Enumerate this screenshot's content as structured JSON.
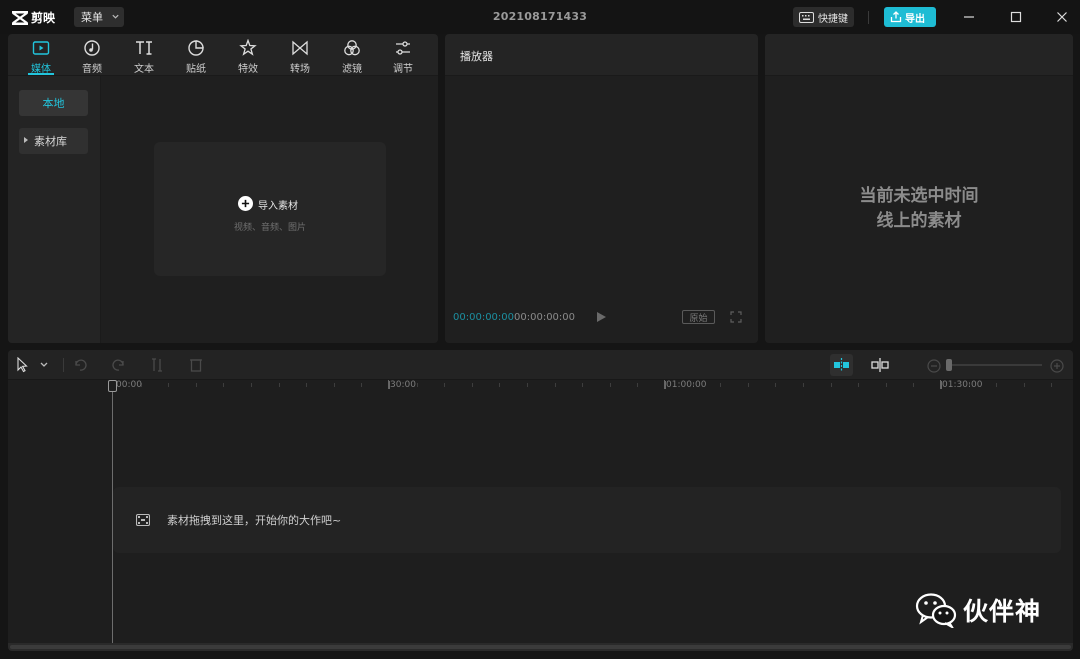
{
  "app": {
    "name": "剪映",
    "menu_label": "菜单",
    "document_title": "202108171433",
    "shortcut_label": "快捷键",
    "export_label": "导出",
    "accent_color": "#22c5dd"
  },
  "media_tabs": [
    {
      "label": "媒体",
      "icon": "media-icon",
      "active": true
    },
    {
      "label": "音频",
      "icon": "audio-icon",
      "active": false
    },
    {
      "label": "文本",
      "icon": "text-icon",
      "active": false
    },
    {
      "label": "贴纸",
      "icon": "sticker-icon",
      "active": false
    },
    {
      "label": "特效",
      "icon": "effects-icon",
      "active": false
    },
    {
      "label": "转场",
      "icon": "transition-icon",
      "active": false
    },
    {
      "label": "滤镜",
      "icon": "filter-icon",
      "active": false
    },
    {
      "label": "调节",
      "icon": "adjust-icon",
      "active": false
    }
  ],
  "media_sidebar": {
    "local": "本地",
    "library": "素材库"
  },
  "import": {
    "label": "导入素材",
    "hint": "视频、音频、图片"
  },
  "player": {
    "title": "播放器",
    "current_time": "00:00:00:00",
    "total_time": "00:00:00:00",
    "ratio_label": "原始"
  },
  "properties": {
    "empty_line1": "当前未选中时间",
    "empty_line2": "线上的素材"
  },
  "timeline": {
    "ruler_labels": [
      "00:00",
      "|30:00",
      "|01:00:00",
      "|01:30:00"
    ],
    "drop_hint": "素材拖拽到这里，开始你的大作吧~"
  },
  "watermark": {
    "text": "伙伴神"
  }
}
